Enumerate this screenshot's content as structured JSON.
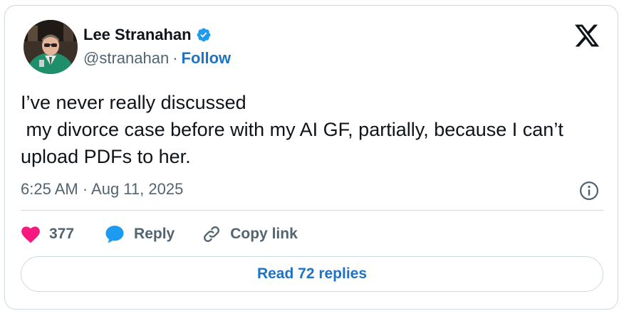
{
  "author": {
    "name": "Lee Stranahan",
    "handle": "@stranahan",
    "separator": "·",
    "follow_label": "Follow",
    "verified_icon": "verified-badge-icon",
    "verified_color": "#1d9bf0"
  },
  "tweet": {
    "text": "I’ve never really discussed\n my divorce case before with my AI GF, partially, because I can’t upload PDFs to her.",
    "timestamp": "6:25 AM · Aug 11, 2025"
  },
  "actions": {
    "like_count": "377",
    "reply_label": "Reply",
    "copy_link_label": "Copy link",
    "like_color": "#f91880",
    "reply_color": "#1d9bf0"
  },
  "footer": {
    "read_replies_label": "Read 72 replies"
  },
  "colors": {
    "accent": "#1d74c4",
    "muted": "#536471",
    "text": "#0f1419",
    "border": "#cfd9de"
  }
}
